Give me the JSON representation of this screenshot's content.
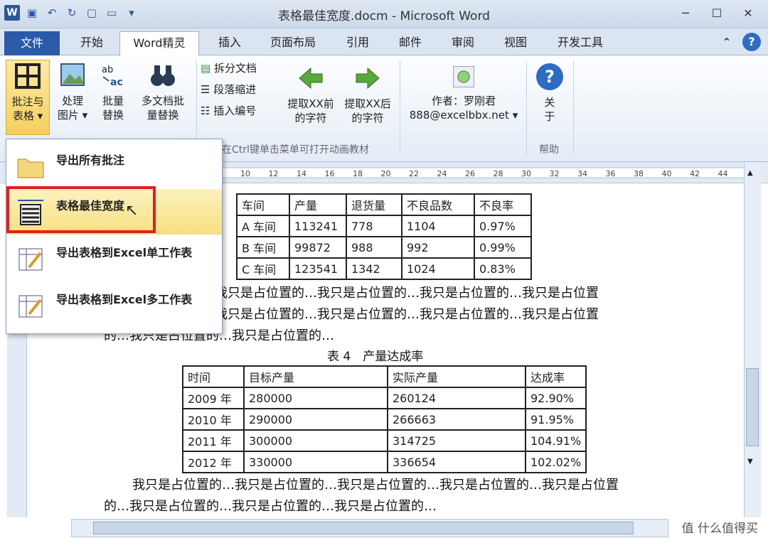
{
  "window": {
    "title": "表格最佳宽度.docm - Microsoft Word"
  },
  "tabs": [
    "文件",
    "开始",
    "Word精灵",
    "插入",
    "页面布局",
    "引用",
    "邮件",
    "审阅",
    "视图",
    "开发工具"
  ],
  "ribbon": {
    "btn1": [
      "批注与",
      "表格"
    ],
    "btn2": [
      "处理",
      "图片"
    ],
    "btn3": [
      "批量",
      "替换"
    ],
    "btn4": [
      "多文档批",
      "量替换"
    ],
    "small": [
      "拆分文档",
      "段落缩进",
      "插入编号"
    ],
    "extract_front": [
      "提取XX前",
      "的字符"
    ],
    "extract_back": [
      "提取XX后",
      "的字符"
    ],
    "author": "作者：罗刚君",
    "email": "888@excelbbx.net",
    "about": [
      "关",
      "于"
    ],
    "group_hint": "在Ctrl键单击菜单可打开动画教材",
    "help_group": "帮助"
  },
  "ruler_ticks": [
    "10",
    "12",
    "14",
    "16",
    "18",
    "20",
    "22",
    "24",
    "26",
    "28",
    "30",
    "32",
    "34",
    "36",
    "38",
    "40",
    "42",
    "44"
  ],
  "menu": [
    {
      "label": "导出所有批注",
      "icon": "folder-icon"
    },
    {
      "label": "表格最佳宽度",
      "icon": "table-width-icon"
    },
    {
      "label": "导出表格到Excel单工作表",
      "icon": "export-sheet-icon"
    },
    {
      "label": "导出表格到Excel多工作表",
      "icon": "export-multi-sheet-icon"
    }
  ],
  "table1": {
    "headers": [
      "车间",
      "产量",
      "退货量",
      "不良品数",
      "不良率"
    ],
    "rows": [
      [
        "A 车间",
        "113241",
        "778",
        "1104",
        "0.97%"
      ],
      [
        "B 车间",
        "99872",
        "988",
        "992",
        "0.99%"
      ],
      [
        "C 车间",
        "123541",
        "1342",
        "1024",
        "0.83%"
      ]
    ]
  },
  "para1": [
    "的…我只是占位置的…我只是占位置的…我只是占位置的…我只是占位置",
    "的…我只是占位置的…我只是占位置的…我只是占位置的…我只是占位置",
    "的…我只是占位置的…我只是占位置的…"
  ],
  "table2": {
    "caption": "表 4　产量达成率",
    "headers": [
      "时间",
      "目标产量",
      "实际产量",
      "达成率"
    ],
    "rows": [
      [
        "2009 年",
        "280000",
        "260124",
        "92.90%"
      ],
      [
        "2010 年",
        "290000",
        "266663",
        "91.95%"
      ],
      [
        "2011 年",
        "300000",
        "314725",
        "104.91%"
      ],
      [
        "2012 年",
        "330000",
        "336654",
        "102.02%"
      ]
    ]
  },
  "para2": [
    "我只是占位置的…我只是占位置的…我只是占位置的…我只是占位置的…我只是占位置",
    "的…我只是占位置的…我只是占位置的…我只是占位置的…"
  ],
  "watermark": "值 什么值得买"
}
